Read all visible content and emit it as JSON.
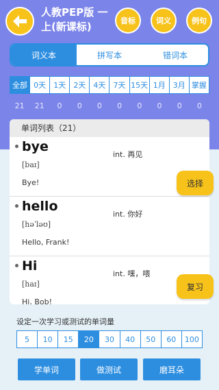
{
  "header": {
    "title": "人教PEP版 一上(新课标)",
    "btn_phonetic": "音标",
    "btn_meaning": "词义",
    "btn_example": "例句"
  },
  "tabs": [
    "词义本",
    "拼写本",
    "错词本"
  ],
  "filters": {
    "labels": [
      "全部",
      "0天",
      "1天",
      "2天",
      "4天",
      "7天",
      "15天",
      "1月",
      "3月",
      "掌握"
    ],
    "counts": [
      "21",
      "21",
      "0",
      "0",
      "0",
      "0",
      "0",
      "0",
      "0",
      "0"
    ]
  },
  "list": {
    "header": "单词列表（21）",
    "items": [
      {
        "word": "bye",
        "phonetic": "[baɪ]",
        "meaning": "int. 再见",
        "example": "Bye!"
      },
      {
        "word": "hello",
        "phonetic": "[həˈləʊ]",
        "meaning": "int. 你好",
        "example": "Hello, Frank!"
      },
      {
        "word": "Hi",
        "phonetic": "[haɪ]",
        "meaning": "int. 嘿，喂",
        "example": "Hi, Bob!"
      }
    ]
  },
  "side_buttons": {
    "select": "选择",
    "review": "复习"
  },
  "quantity": {
    "hint": "设定一次学习或测试的单词量",
    "options": [
      "5",
      "10",
      "15",
      "20",
      "30",
      "40",
      "50",
      "60",
      "100"
    ],
    "selected": "20"
  },
  "actions": {
    "learn": "学单词",
    "test": "做测试",
    "listen": "磨耳朵"
  },
  "colors": {
    "header_bg": "#7b84e8",
    "accent": "#2d8ee0",
    "button_yellow": "#f7c21a"
  }
}
